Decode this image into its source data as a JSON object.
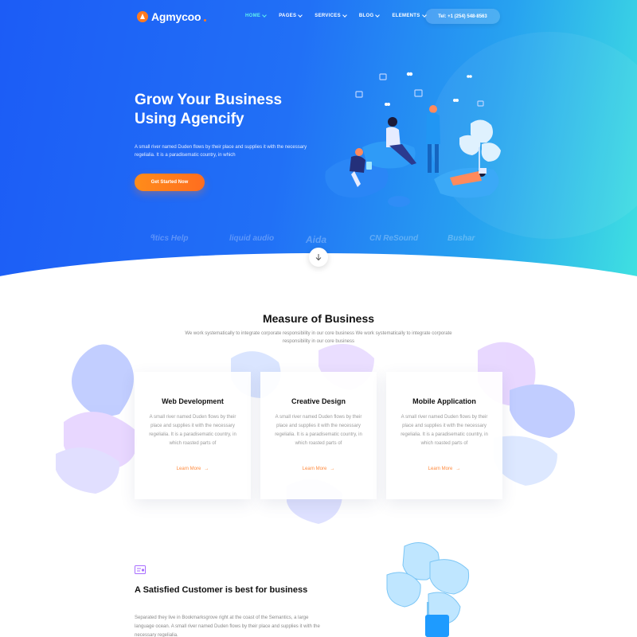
{
  "nav": {
    "logo_text": "Agmycoo",
    "items": [
      {
        "label": "HOME",
        "active": true,
        "dropdown": true
      },
      {
        "label": "PAGES",
        "active": false,
        "dropdown": true
      },
      {
        "label": "SERVICES",
        "active": false,
        "dropdown": true
      },
      {
        "label": "BLOG",
        "active": false,
        "dropdown": true
      },
      {
        "label": "ELEMENTS",
        "active": false,
        "dropdown": true
      }
    ],
    "phone": "Tel: +1 (254) 548-8563"
  },
  "hero": {
    "title_line1": "Grow Your Business",
    "title_line2": "Using Agencify",
    "text": "A small river named Duden flows by their place and supplies it with the necessary regelialia. It is a paradisematic country, in which",
    "cta_label": "Get Started Now",
    "brands": [
      "⁰itics Help",
      "liquid audio",
      "Aida",
      "CN ReSound",
      "Bushar"
    ]
  },
  "measure": {
    "title": "Measure of Business",
    "subtitle": "We work systematically to integrate corporate responsibility in our core business We work systematically to integrate corporate responsibility in our core business",
    "cards": [
      {
        "title": "Web Development",
        "text": "A small river named Duden flows by their place and supplies it with the necessary regelialia. It is a paradisematic country, in which roasted parts of",
        "link": "Learn More"
      },
      {
        "title": "Creative Design",
        "text": "A small river named Duden flows by their place and supplies it with the necessary regelialia. It is a paradisematic country, in which roasted parts of",
        "link": "Learn More"
      },
      {
        "title": "Mobile Application",
        "text": "A small river named Duden flows by their place and supplies it with the necessary regelialia. It is a paradisematic country, in which roasted parts of",
        "link": "Learn More"
      }
    ]
  },
  "satisfied": {
    "title": "A Satisfied Customer is best for business",
    "text": "Separated they live in Bookmarksgrove right at the coast of the Semantics, a large language ocean. A small river named Duden flows by their place and supplies it with the necessary regelialia."
  },
  "colors": {
    "accent_orange": "#ff7a1f",
    "hero_blue": "#1c5cf6",
    "hero_cyan": "#3fe0e1",
    "active_nav": "#5ff0ee"
  }
}
